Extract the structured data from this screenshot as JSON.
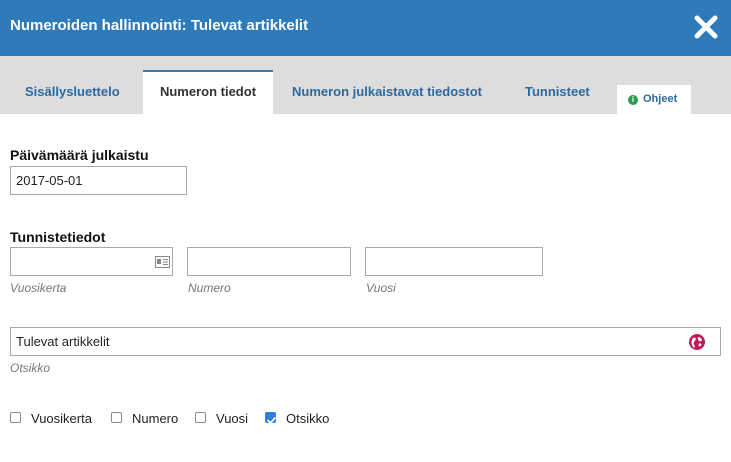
{
  "dialog": {
    "title": "Numeroiden hallinnointi: Tulevat artikkelit"
  },
  "tabs": [
    {
      "label": "Sisällysluettelo",
      "active": false
    },
    {
      "label": "Numeron tiedot",
      "active": true
    },
    {
      "label": "Numeron julkaistavat tiedostot",
      "active": false
    },
    {
      "label": "Tunnisteet",
      "active": false
    }
  ],
  "help": {
    "label": "Ohjeet",
    "icon": "info-icon"
  },
  "form": {
    "date_published_label": "Päivämäärä julkaistu",
    "date_published_value": "2017-05-01",
    "identification_label": "Tunnistetiedot",
    "volume_value": "",
    "volume_hint": "Vuosikerta",
    "number_value": "",
    "number_hint": "Numero",
    "year_value": "",
    "year_hint": "Vuosi",
    "title_value": "Tulevat artikkelit",
    "title_hint": "Otsikko"
  },
  "show_options": [
    {
      "label": "Vuosikerta",
      "checked": false
    },
    {
      "label": "Numero",
      "checked": false
    },
    {
      "label": "Vuosi",
      "checked": false
    },
    {
      "label": "Otsikko",
      "checked": true
    }
  ],
  "colors": {
    "header": "#2f7ab8",
    "tab_link": "#2c6aa0",
    "checkbox_checked": "#2f7fd9",
    "globe": "#c2185b",
    "info": "#2e9d4c"
  }
}
